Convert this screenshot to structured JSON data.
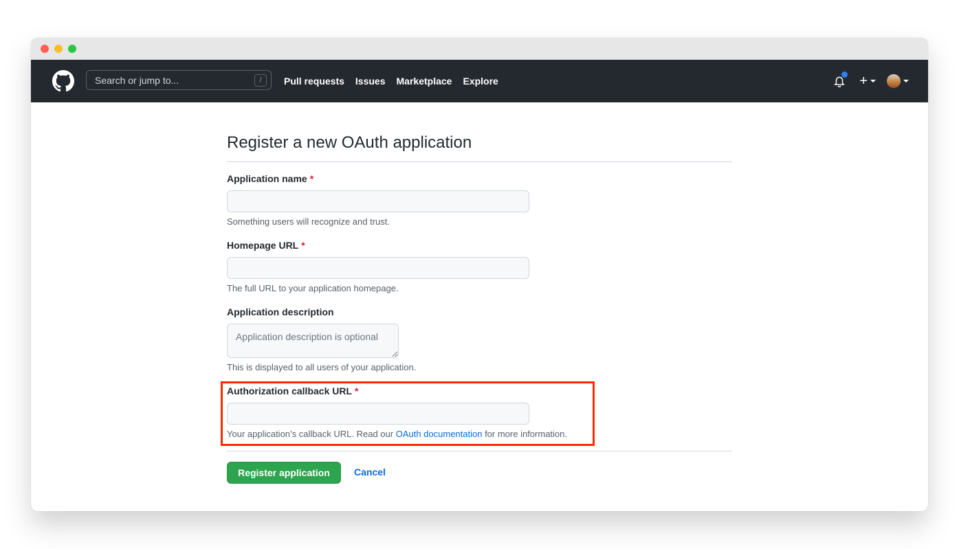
{
  "header": {
    "search_placeholder": "Search or jump to...",
    "search_shortcut": "/",
    "nav": [
      {
        "label": "Pull requests"
      },
      {
        "label": "Issues"
      },
      {
        "label": "Marketplace"
      },
      {
        "label": "Explore"
      }
    ],
    "create_label": "+",
    "icons": {
      "logo": "github-logo-icon",
      "notifications": "bell-icon",
      "notification_dot_color": "#2f81f7"
    }
  },
  "page": {
    "title": "Register a new OAuth application",
    "fields": [
      {
        "label": "Application name",
        "required_marker": "*",
        "value": "",
        "note": "Something users will recognize and trust."
      },
      {
        "label": "Homepage URL",
        "required_marker": "*",
        "value": "",
        "note": "The full URL to your application homepage."
      },
      {
        "label": "Application description",
        "placeholder": "Application description is optional",
        "value": "",
        "note": "This is displayed to all users of your application."
      },
      {
        "label": "Authorization callback URL",
        "required_marker": "*",
        "value": "",
        "note_prefix": "Your application’s callback URL. Read our ",
        "note_link": "OAuth documentation",
        "note_suffix": " for more information."
      }
    ],
    "submit_label": "Register application",
    "cancel_label": "Cancel"
  },
  "colors": {
    "header_bg": "#24292f",
    "primary_button": "#2da44e",
    "link": "#0969da",
    "required": "#cf222e",
    "highlight_box": "#ff2a00"
  }
}
